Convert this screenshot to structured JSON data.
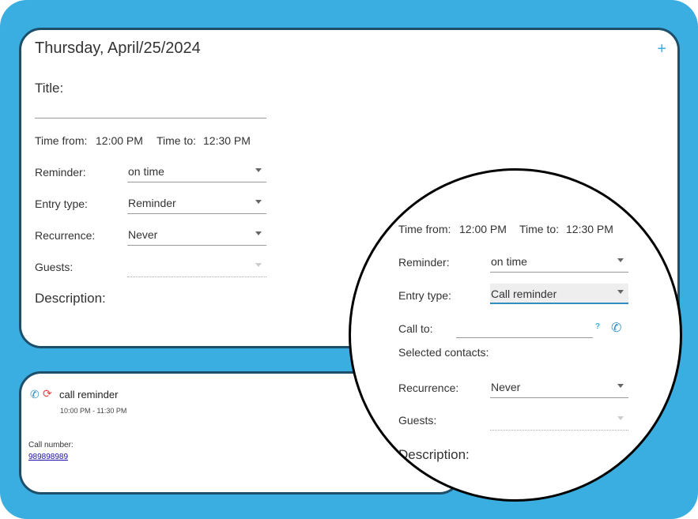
{
  "form": {
    "date_title": "Thursday, April/25/2024",
    "add_icon": "+",
    "title_label": "Title:",
    "time_from_label": "Time from:",
    "time_from_value": "12:00 PM",
    "time_to_label": "Time to:",
    "time_to_value": "12:30 PM",
    "reminder_label": "Reminder:",
    "reminder_value": "on time",
    "entry_type_label": "Entry type:",
    "entry_type_value": "Reminder",
    "recurrence_label": "Recurrence:",
    "recurrence_value": "Never",
    "guests_label": "Guests:",
    "description_label": "Description:"
  },
  "event": {
    "title": "call reminder",
    "time": "10:00 PM - 11:30 PM",
    "call_number_label": "Call number:",
    "call_number": "989898989"
  },
  "zoom": {
    "time_from_label": "Time from:",
    "time_from_value": "12:00 PM",
    "time_to_label": "Time to:",
    "time_to_value": "12:30 PM",
    "reminder_label": "Reminder:",
    "reminder_value": "on time",
    "entry_type_label": "Entry type:",
    "entry_type_value": "Call reminder",
    "call_to_label": "Call to:",
    "help_mark": "?",
    "selected_contacts_label": "Selected contacts:",
    "recurrence_label": "Recurrence:",
    "recurrence_value": "Never",
    "guests_label": "Guests:",
    "description_label": "Description:"
  },
  "colors": {
    "frame": "#3aaee0",
    "card_border": "#1d4f6b",
    "accent": "#2e8ec4",
    "repeat_icon": "#e04848"
  },
  "icons": {
    "add": "plus-icon",
    "phone": "phone-icon",
    "repeat": "repeat-icon",
    "contacts": "contact-phone-icon",
    "caret": "caret-down-icon"
  }
}
